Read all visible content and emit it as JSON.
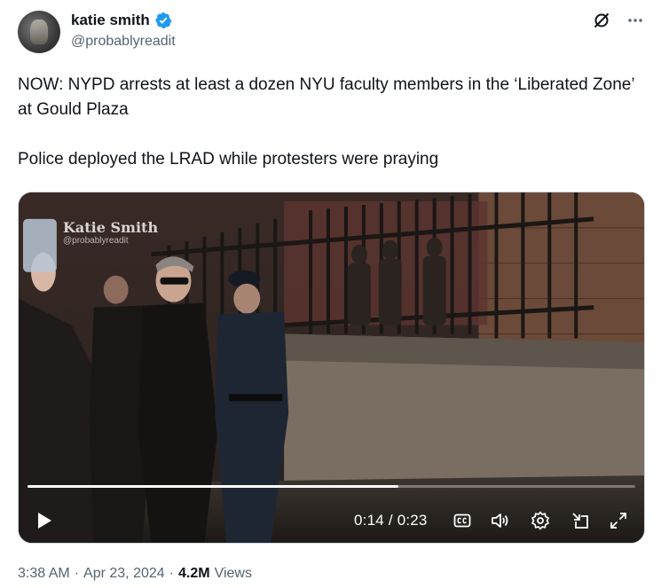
{
  "author": {
    "display_name": "katie smith",
    "handle": "@probablyreadit",
    "verified": true
  },
  "tweet": {
    "paragraph_1": "NOW: NYPD arrests at least a dozen NYU faculty members in the ‘Liberated Zone’ at Gould Plaza",
    "paragraph_2": "Police deployed the LRAD while protesters were praying"
  },
  "video": {
    "watermark_name": "Katie Smith",
    "watermark_handle": "@probablyreadit",
    "current_time": "0:14",
    "separator": "/",
    "duration": "0:23",
    "progress_fraction": 0.61
  },
  "footer": {
    "time": "3:38 AM",
    "date": "Apr 23, 2024",
    "views_count": "4.2M",
    "views_label": "Views",
    "dot": "·"
  },
  "colors": {
    "verified_blue": "#1d9bf0",
    "secondary_text": "#536471",
    "primary_text": "#0f1419"
  },
  "icons": [
    "verified-badge-icon",
    "grok-icon",
    "more-icon",
    "play-icon",
    "captions-icon",
    "volume-icon",
    "settings-icon",
    "minimize-icon",
    "fullscreen-icon"
  ]
}
